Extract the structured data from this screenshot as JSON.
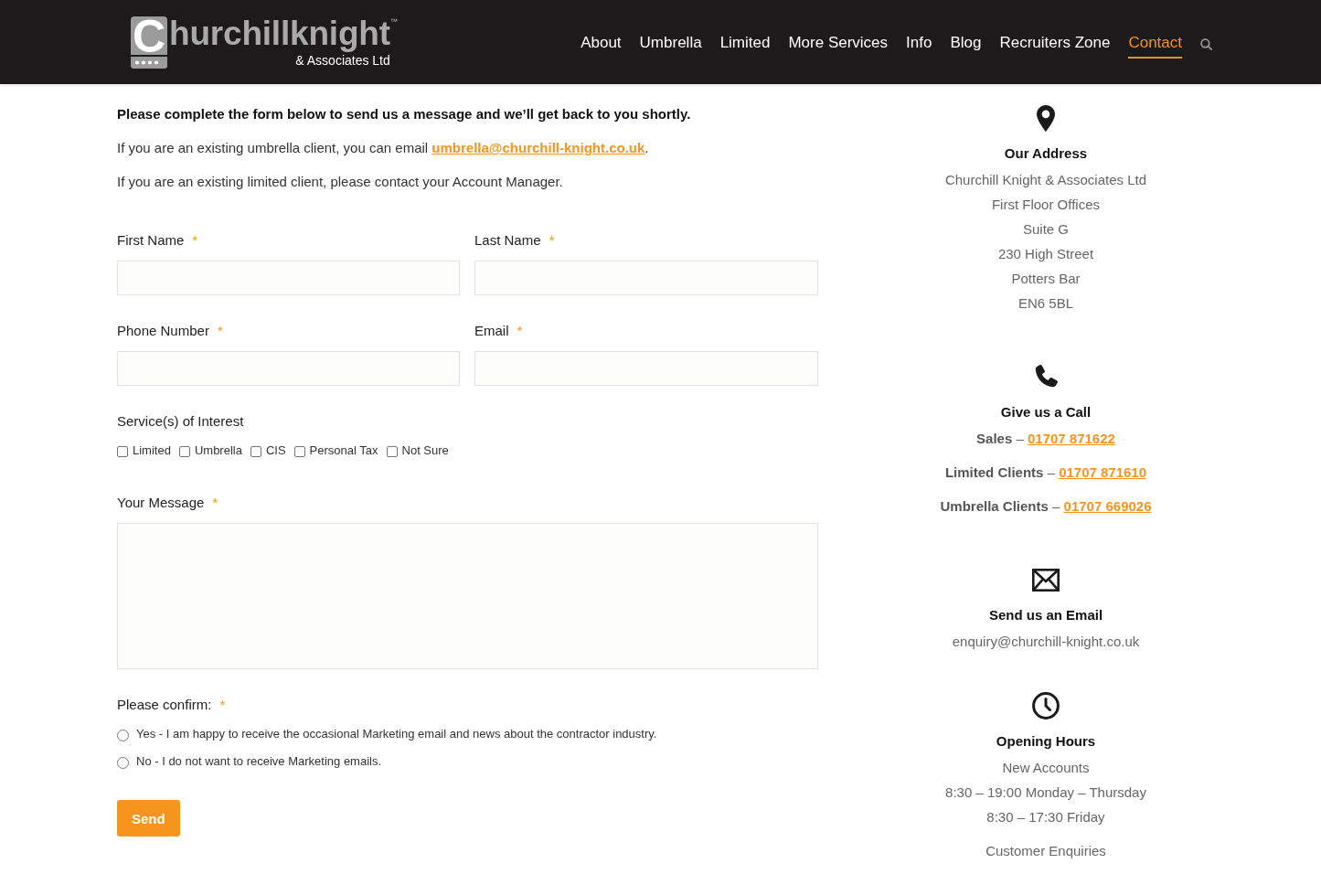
{
  "header": {
    "logo": {
      "initial": "C",
      "wordmark": "hurchillknight",
      "trademark": "™",
      "subtitle": "& Associates Ltd"
    },
    "nav": [
      {
        "label": "About",
        "selected": false
      },
      {
        "label": "Umbrella",
        "selected": false
      },
      {
        "label": "Limited",
        "selected": false
      },
      {
        "label": "More Services",
        "selected": false
      },
      {
        "label": "Info",
        "selected": false
      },
      {
        "label": "Blog",
        "selected": false
      },
      {
        "label": "Recruiters Zone",
        "selected": false
      },
      {
        "label": "Contact",
        "selected": true
      }
    ]
  },
  "intro": {
    "lead": "Please complete the form below to send us a message and we’ll get back to you shortly.",
    "umbrella_note": {
      "text": "If you are an existing umbrella client, you can email ",
      "link": "umbrella@churchill-knight.co.uk",
      "end": "."
    },
    "limited_note": "If you are an existing limited client, please contact your Account Manager."
  },
  "form": {
    "field_rows": [
      {
        "fields": [
          {
            "label": "First Name",
            "required_mark": "*"
          },
          {
            "label": "Last Name",
            "required_mark": "*"
          }
        ]
      },
      {
        "fields": [
          {
            "label": "Phone Number",
            "required_mark": "*"
          },
          {
            "label": "Email",
            "required_mark": "*"
          }
        ]
      }
    ],
    "services": {
      "label": "Service(s) of Interest",
      "options": [
        {
          "label": "Limited",
          "checked": false
        },
        {
          "label": "Umbrella",
          "checked": false
        },
        {
          "label": "CIS",
          "checked": false
        },
        {
          "label": "Personal Tax",
          "checked": false
        },
        {
          "label": "Not Sure",
          "checked": false
        }
      ]
    },
    "message": {
      "label": "Your Message",
      "required_mark": "*"
    },
    "confirm": {
      "label": "Please confirm:",
      "required_mark": "*",
      "options": [
        {
          "label": "Yes - I am happy to receive the occasional Marketing email and news about the contractor industry.",
          "selected": false
        },
        {
          "label": "No - I do not want to receive Marketing emails.",
          "selected": false
        }
      ]
    },
    "submit": "Send"
  },
  "sidebar": {
    "sections": [
      {
        "kind": "address",
        "title": "Our Address",
        "lines": [
          "Churchill Knight & Associates Ltd",
          "First Floor Offices",
          "Suite G",
          "230 High Street",
          "Potters Bar",
          "EN6 5BL"
        ]
      },
      {
        "kind": "phone",
        "title": "Give us a Call",
        "numbers": [
          {
            "label": "Sales",
            "dash": "–",
            "number": "01707 871622"
          },
          {
            "label": "Limited Clients",
            "dash": "–",
            "number": "01707 871610"
          },
          {
            "label": "Umbrella Clients",
            "dash": "–",
            "number": "01707 669026"
          }
        ]
      },
      {
        "kind": "email",
        "title": "Send us an Email",
        "lines": [
          "enquiry@churchill-knight.co.uk"
        ]
      },
      {
        "kind": "hours",
        "title": "Opening Hours",
        "groups": [
          {
            "heading": "New Accounts",
            "lines": [
              "8:30 – 19:00 Monday – Thursday",
              "8:30 – 17:30 Friday"
            ]
          },
          {
            "heading": "Customer Enquiries"
          }
        ]
      }
    ]
  }
}
